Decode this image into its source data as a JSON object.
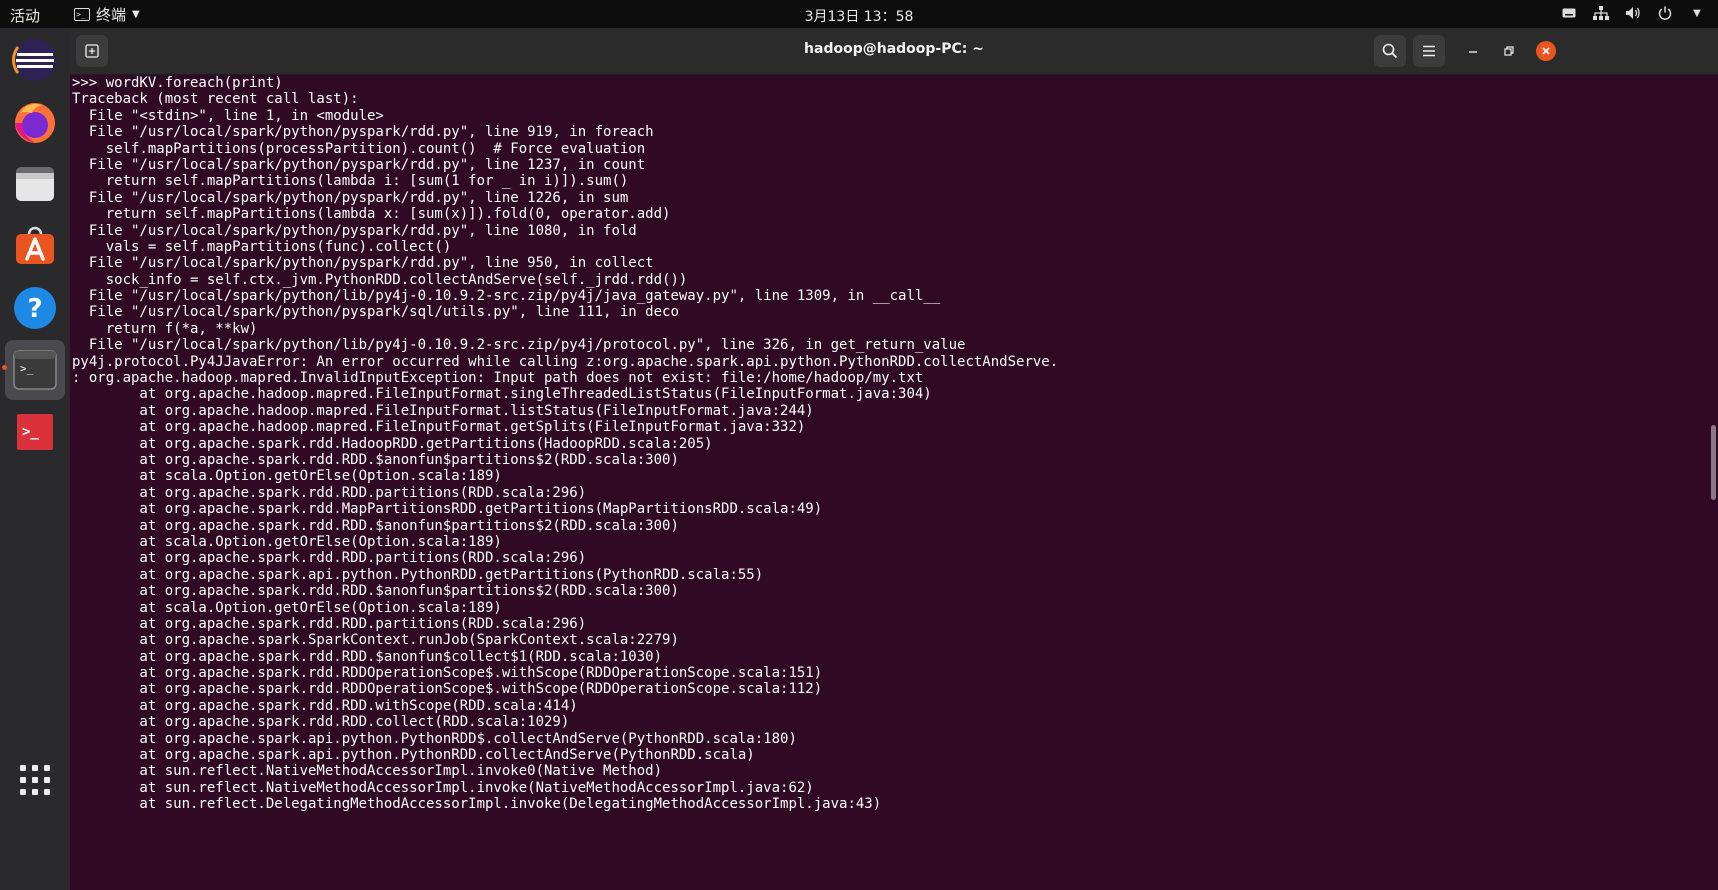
{
  "topbar": {
    "activities": "活动",
    "app_name": "终端",
    "clock": "3月13日 13：58",
    "tray_icons": [
      "keyboard-icon",
      "network-icon",
      "volume-icon",
      "power-icon",
      "chevron-down-icon"
    ]
  },
  "dock": {
    "items": [
      {
        "name": "eclipse",
        "icon": "eclipse-icon"
      },
      {
        "name": "firefox",
        "icon": "firefox-icon"
      },
      {
        "name": "files",
        "icon": "files-icon"
      },
      {
        "name": "software",
        "icon": "software-icon"
      },
      {
        "name": "help",
        "icon": "help-icon"
      },
      {
        "name": "terminal",
        "icon": "terminal-icon",
        "active": true
      },
      {
        "name": "remote",
        "icon": "remote-terminal-icon"
      }
    ],
    "show_apps_icon": "grid-icon"
  },
  "window": {
    "title": "hadoop@hadoop-PC: ~",
    "buttons": [
      "new-tab",
      "search",
      "menu",
      "minimize",
      "maximize",
      "close"
    ]
  },
  "colors": {
    "terminal_bg": "#300a24",
    "accent": "#e95420",
    "topbar_bg": "#0d0d0d",
    "dock_bg": "#2a2a2d"
  },
  "terminal": {
    "lines": [
      ">>> wordKV.foreach(print)",
      "Traceback (most recent call last):",
      "  File \"<stdin>\", line 1, in <module>",
      "  File \"/usr/local/spark/python/pyspark/rdd.py\", line 919, in foreach",
      "    self.mapPartitions(processPartition).count()  # Force evaluation",
      "  File \"/usr/local/spark/python/pyspark/rdd.py\", line 1237, in count",
      "    return self.mapPartitions(lambda i: [sum(1 for _ in i)]).sum()",
      "  File \"/usr/local/spark/python/pyspark/rdd.py\", line 1226, in sum",
      "    return self.mapPartitions(lambda x: [sum(x)]).fold(0, operator.add)",
      "  File \"/usr/local/spark/python/pyspark/rdd.py\", line 1080, in fold",
      "    vals = self.mapPartitions(func).collect()",
      "  File \"/usr/local/spark/python/pyspark/rdd.py\", line 950, in collect",
      "    sock_info = self.ctx._jvm.PythonRDD.collectAndServe(self._jrdd.rdd())",
      "  File \"/usr/local/spark/python/lib/py4j-0.10.9.2-src.zip/py4j/java_gateway.py\", line 1309, in __call__",
      "  File \"/usr/local/spark/python/pyspark/sql/utils.py\", line 111, in deco",
      "    return f(*a, **kw)",
      "  File \"/usr/local/spark/python/lib/py4j-0.10.9.2-src.zip/py4j/protocol.py\", line 326, in get_return_value",
      "py4j.protocol.Py4JJavaError: An error occurred while calling z:org.apache.spark.api.python.PythonRDD.collectAndServe.",
      ": org.apache.hadoop.mapred.InvalidInputException: Input path does not exist: file:/home/hadoop/my.txt",
      "        at org.apache.hadoop.mapred.FileInputFormat.singleThreadedListStatus(FileInputFormat.java:304)",
      "        at org.apache.hadoop.mapred.FileInputFormat.listStatus(FileInputFormat.java:244)",
      "        at org.apache.hadoop.mapred.FileInputFormat.getSplits(FileInputFormat.java:332)",
      "        at org.apache.spark.rdd.HadoopRDD.getPartitions(HadoopRDD.scala:205)",
      "        at org.apache.spark.rdd.RDD.$anonfun$partitions$2(RDD.scala:300)",
      "        at scala.Option.getOrElse(Option.scala:189)",
      "        at org.apache.spark.rdd.RDD.partitions(RDD.scala:296)",
      "        at org.apache.spark.rdd.MapPartitionsRDD.getPartitions(MapPartitionsRDD.scala:49)",
      "        at org.apache.spark.rdd.RDD.$anonfun$partitions$2(RDD.scala:300)",
      "        at scala.Option.getOrElse(Option.scala:189)",
      "        at org.apache.spark.rdd.RDD.partitions(RDD.scala:296)",
      "        at org.apache.spark.api.python.PythonRDD.getPartitions(PythonRDD.scala:55)",
      "        at org.apache.spark.rdd.RDD.$anonfun$partitions$2(RDD.scala:300)",
      "        at scala.Option.getOrElse(Option.scala:189)",
      "        at org.apache.spark.rdd.RDD.partitions(RDD.scala:296)",
      "        at org.apache.spark.SparkContext.runJob(SparkContext.scala:2279)",
      "        at org.apache.spark.rdd.RDD.$anonfun$collect$1(RDD.scala:1030)",
      "        at org.apache.spark.rdd.RDDOperationScope$.withScope(RDDOperationScope.scala:151)",
      "        at org.apache.spark.rdd.RDDOperationScope$.withScope(RDDOperationScope.scala:112)",
      "        at org.apache.spark.rdd.RDD.withScope(RDD.scala:414)",
      "        at org.apache.spark.rdd.RDD.collect(RDD.scala:1029)",
      "        at org.apache.spark.api.python.PythonRDD$.collectAndServe(PythonRDD.scala:180)",
      "        at org.apache.spark.api.python.PythonRDD.collectAndServe(PythonRDD.scala)",
      "        at sun.reflect.NativeMethodAccessorImpl.invoke0(Native Method)",
      "        at sun.reflect.NativeMethodAccessorImpl.invoke(NativeMethodAccessorImpl.java:62)",
      "        at sun.reflect.DelegatingMethodAccessorImpl.invoke(DelegatingMethodAccessorImpl.java:43)"
    ]
  }
}
